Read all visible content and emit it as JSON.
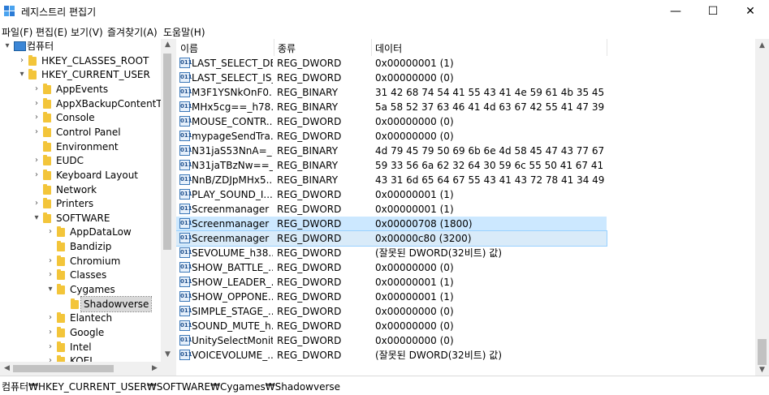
{
  "window": {
    "title": "레지스트리 편집기",
    "minimize": "—",
    "maximize": "☐",
    "close": "✕"
  },
  "menu": [
    "파일(F)",
    "편집(E)",
    "보기(V)",
    "즐겨찾기(A)",
    "도움말(H)"
  ],
  "tree": [
    {
      "label": "컴퓨터",
      "level": 0,
      "chevron": "▾",
      "icon": "computer"
    },
    {
      "label": "HKEY_CLASSES_ROOT",
      "level": 1,
      "chevron": "›",
      "icon": "folder"
    },
    {
      "label": "HKEY_CURRENT_USER",
      "level": 1,
      "chevron": "▾",
      "icon": "folder"
    },
    {
      "label": "AppEvents",
      "level": 2,
      "chevron": "›",
      "icon": "folder"
    },
    {
      "label": "AppXBackupContentType",
      "level": 2,
      "chevron": "›",
      "icon": "folder"
    },
    {
      "label": "Console",
      "level": 2,
      "chevron": "›",
      "icon": "folder"
    },
    {
      "label": "Control Panel",
      "level": 2,
      "chevron": "›",
      "icon": "folder"
    },
    {
      "label": "Environment",
      "level": 2,
      "chevron": "",
      "icon": "folder"
    },
    {
      "label": "EUDC",
      "level": 2,
      "chevron": "›",
      "icon": "folder"
    },
    {
      "label": "Keyboard Layout",
      "level": 2,
      "chevron": "›",
      "icon": "folder"
    },
    {
      "label": "Network",
      "level": 2,
      "chevron": "",
      "icon": "folder"
    },
    {
      "label": "Printers",
      "level": 2,
      "chevron": "›",
      "icon": "folder"
    },
    {
      "label": "SOFTWARE",
      "level": 2,
      "chevron": "▾",
      "icon": "folder"
    },
    {
      "label": "AppDataLow",
      "level": 3,
      "chevron": "›",
      "icon": "folder"
    },
    {
      "label": "Bandizip",
      "level": 3,
      "chevron": "",
      "icon": "folder"
    },
    {
      "label": "Chromium",
      "level": 3,
      "chevron": "›",
      "icon": "folder"
    },
    {
      "label": "Classes",
      "level": 3,
      "chevron": "›",
      "icon": "folder"
    },
    {
      "label": "Cygames",
      "level": 3,
      "chevron": "▾",
      "icon": "folder"
    },
    {
      "label": "Shadowverse",
      "level": 4,
      "chevron": "",
      "icon": "folder",
      "selected": true
    },
    {
      "label": "Elantech",
      "level": 3,
      "chevron": "›",
      "icon": "folder"
    },
    {
      "label": "Google",
      "level": 3,
      "chevron": "›",
      "icon": "folder"
    },
    {
      "label": "Intel",
      "level": 3,
      "chevron": "›",
      "icon": "folder"
    },
    {
      "label": "KOEI",
      "level": 3,
      "chevron": "›",
      "icon": "folder"
    }
  ],
  "list": {
    "headers": {
      "name": "이름",
      "type": "종류",
      "data": "데이터"
    },
    "rows": [
      {
        "name": "LAST_SELECT_DE...",
        "type": "REG_DWORD",
        "data": "0x00000001 (1)"
      },
      {
        "name": "LAST_SELECT_IS_...",
        "type": "REG_DWORD",
        "data": "0x00000000 (0)"
      },
      {
        "name": "M3F1YSNkOnF0...",
        "type": "REG_BINARY",
        "data": "31 42 68 74 54 41 55 43 41 4e 59 61 4b 35 45 ..."
      },
      {
        "name": "MHx5cg==_h78...",
        "type": "REG_BINARY",
        "data": "5a 58 52 37 63 46 41 4d 63 67 42 55 41 47 39 ..."
      },
      {
        "name": "MOUSE_CONTR...",
        "type": "REG_DWORD",
        "data": "0x00000000 (0)"
      },
      {
        "name": "mypageSendTra...",
        "type": "REG_DWORD",
        "data": "0x00000000 (0)"
      },
      {
        "name": "N31jaS53NnA=_...",
        "type": "REG_BINARY",
        "data": "4d 79 45 79 50 69 6b 6e 4d 58 45 47 43 77 67 ..."
      },
      {
        "name": "N31jaTBzNw==_...",
        "type": "REG_BINARY",
        "data": "59 33 56 6a 62 32 64 30 59 6c 55 50 41 67 41 ..."
      },
      {
        "name": "NnB/ZDJpMHx5...",
        "type": "REG_BINARY",
        "data": "43 31 6d 65 64 67 55 43 41 43 72 78 41 34 49 ..."
      },
      {
        "name": "PLAY_SOUND_I...",
        "type": "REG_DWORD",
        "data": "0x00000001 (1)"
      },
      {
        "name": "Screenmanager I...",
        "type": "REG_DWORD",
        "data": "0x00000001 (1)"
      },
      {
        "name": "Screenmanager ...",
        "type": "REG_DWORD",
        "data": "0x00000708 (1800)",
        "state": "sel"
      },
      {
        "name": "Screenmanager ...",
        "type": "REG_DWORD",
        "data": "0x00000c80 (3200)",
        "state": "focus"
      },
      {
        "name": "SEVOLUME_h38...",
        "type": "REG_DWORD",
        "data": "(잘못된 DWORD(32비트) 값)"
      },
      {
        "name": "SHOW_BATTLE_...",
        "type": "REG_DWORD",
        "data": "0x00000000 (0)"
      },
      {
        "name": "SHOW_LEADER_...",
        "type": "REG_DWORD",
        "data": "0x00000001 (1)"
      },
      {
        "name": "SHOW_OPPONE...",
        "type": "REG_DWORD",
        "data": "0x00000001 (1)"
      },
      {
        "name": "SIMPLE_STAGE_...",
        "type": "REG_DWORD",
        "data": "0x00000000 (0)"
      },
      {
        "name": "SOUND_MUTE_h...",
        "type": "REG_DWORD",
        "data": "0x00000000 (0)"
      },
      {
        "name": "UnitySelectMonit...",
        "type": "REG_DWORD",
        "data": "0x00000000 (0)"
      },
      {
        "name": "VOICEVOLUME_...",
        "type": "REG_DWORD",
        "data": "(잘못된 DWORD(32비트) 값)"
      }
    ]
  },
  "status": {
    "path": "컴퓨터₩HKEY_CURRENT_USER₩SOFTWARE₩Cygames₩Shadowverse"
  },
  "icons": {
    "app": "registry-editor-icon",
    "value": "reg-value-icon",
    "folder": "folder-icon"
  }
}
